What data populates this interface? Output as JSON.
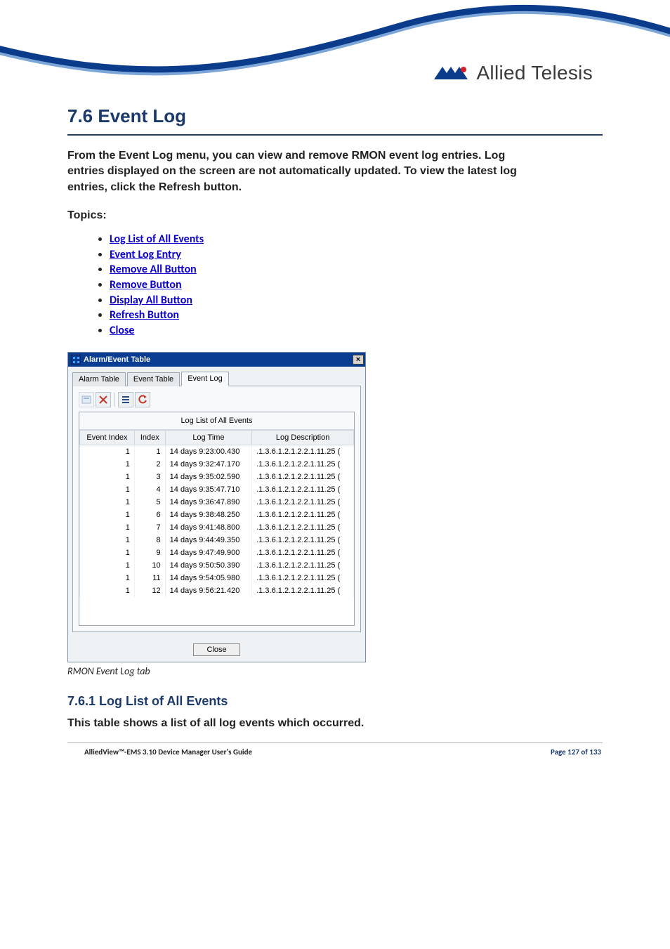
{
  "brand": {
    "name": "Allied Telesis"
  },
  "section": {
    "title": "7.6 Event Log",
    "intro": "From the Event Log menu, you can view and remove RMON event log entries. Log entries displayed on the screen are not automatically updated. To view the latest log entries, click the Refresh button.",
    "topics_label": "Topics:",
    "topics": [
      "Log List of All Events",
      "Event Log Entry",
      "Remove All Button",
      "Remove Button",
      "Display All Button",
      "Refresh Button",
      "Close"
    ]
  },
  "screenshot": {
    "window_title": "Alarm/Event Table",
    "tabs": {
      "alarm": "Alarm Table",
      "event": "Event Table",
      "log": "Event Log"
    },
    "toolbar": {
      "icons": [
        "display-all-icon",
        "remove-icon",
        "list-icon",
        "refresh-icon"
      ]
    },
    "table_title": "Log List of All Events",
    "columns": {
      "event_index": "Event Index",
      "index": "Index",
      "log_time": "Log Time",
      "log_description": "Log Description"
    },
    "rows": [
      {
        "event_index": "1",
        "index": "1",
        "log_time": "14 days 9:23:00.430",
        "log_description": ".1.3.6.1.2.1.2.2.1.11.25 ("
      },
      {
        "event_index": "1",
        "index": "2",
        "log_time": "14 days 9:32:47.170",
        "log_description": ".1.3.6.1.2.1.2.2.1.11.25 ("
      },
      {
        "event_index": "1",
        "index": "3",
        "log_time": "14 days 9:35:02.590",
        "log_description": ".1.3.6.1.2.1.2.2.1.11.25 ("
      },
      {
        "event_index": "1",
        "index": "4",
        "log_time": "14 days 9:35:47.710",
        "log_description": ".1.3.6.1.2.1.2.2.1.11.25 ("
      },
      {
        "event_index": "1",
        "index": "5",
        "log_time": "14 days 9:36:47.890",
        "log_description": ".1.3.6.1.2.1.2.2.1.11.25 ("
      },
      {
        "event_index": "1",
        "index": "6",
        "log_time": "14 days 9:38:48.250",
        "log_description": ".1.3.6.1.2.1.2.2.1.11.25 ("
      },
      {
        "event_index": "1",
        "index": "7",
        "log_time": "14 days 9:41:48.800",
        "log_description": ".1.3.6.1.2.1.2.2.1.11.25 ("
      },
      {
        "event_index": "1",
        "index": "8",
        "log_time": "14 days 9:44:49.350",
        "log_description": ".1.3.6.1.2.1.2.2.1.11.25 ("
      },
      {
        "event_index": "1",
        "index": "9",
        "log_time": "14 days 9:47:49.900",
        "log_description": ".1.3.6.1.2.1.2.2.1.11.25 ("
      },
      {
        "event_index": "1",
        "index": "10",
        "log_time": "14 days 9:50:50.390",
        "log_description": ".1.3.6.1.2.1.2.2.1.11.25 ("
      },
      {
        "event_index": "1",
        "index": "11",
        "log_time": "14 days 9:54:05.980",
        "log_description": ".1.3.6.1.2.1.2.2.1.11.25 ("
      },
      {
        "event_index": "1",
        "index": "12",
        "log_time": "14 days 9:56:21.420",
        "log_description": ".1.3.6.1.2.1.2.2.1.11.25 ("
      }
    ],
    "close_button": "Close",
    "caption": "RMON Event Log tab"
  },
  "subsection": {
    "title": "7.6.1 Log List of All Events",
    "intro": "This table shows a list of all log events which occurred."
  },
  "footer": {
    "left": "AlliedView™-EMS 3.10 Device Manager User's Guide",
    "right": "Page 127 of 133"
  }
}
